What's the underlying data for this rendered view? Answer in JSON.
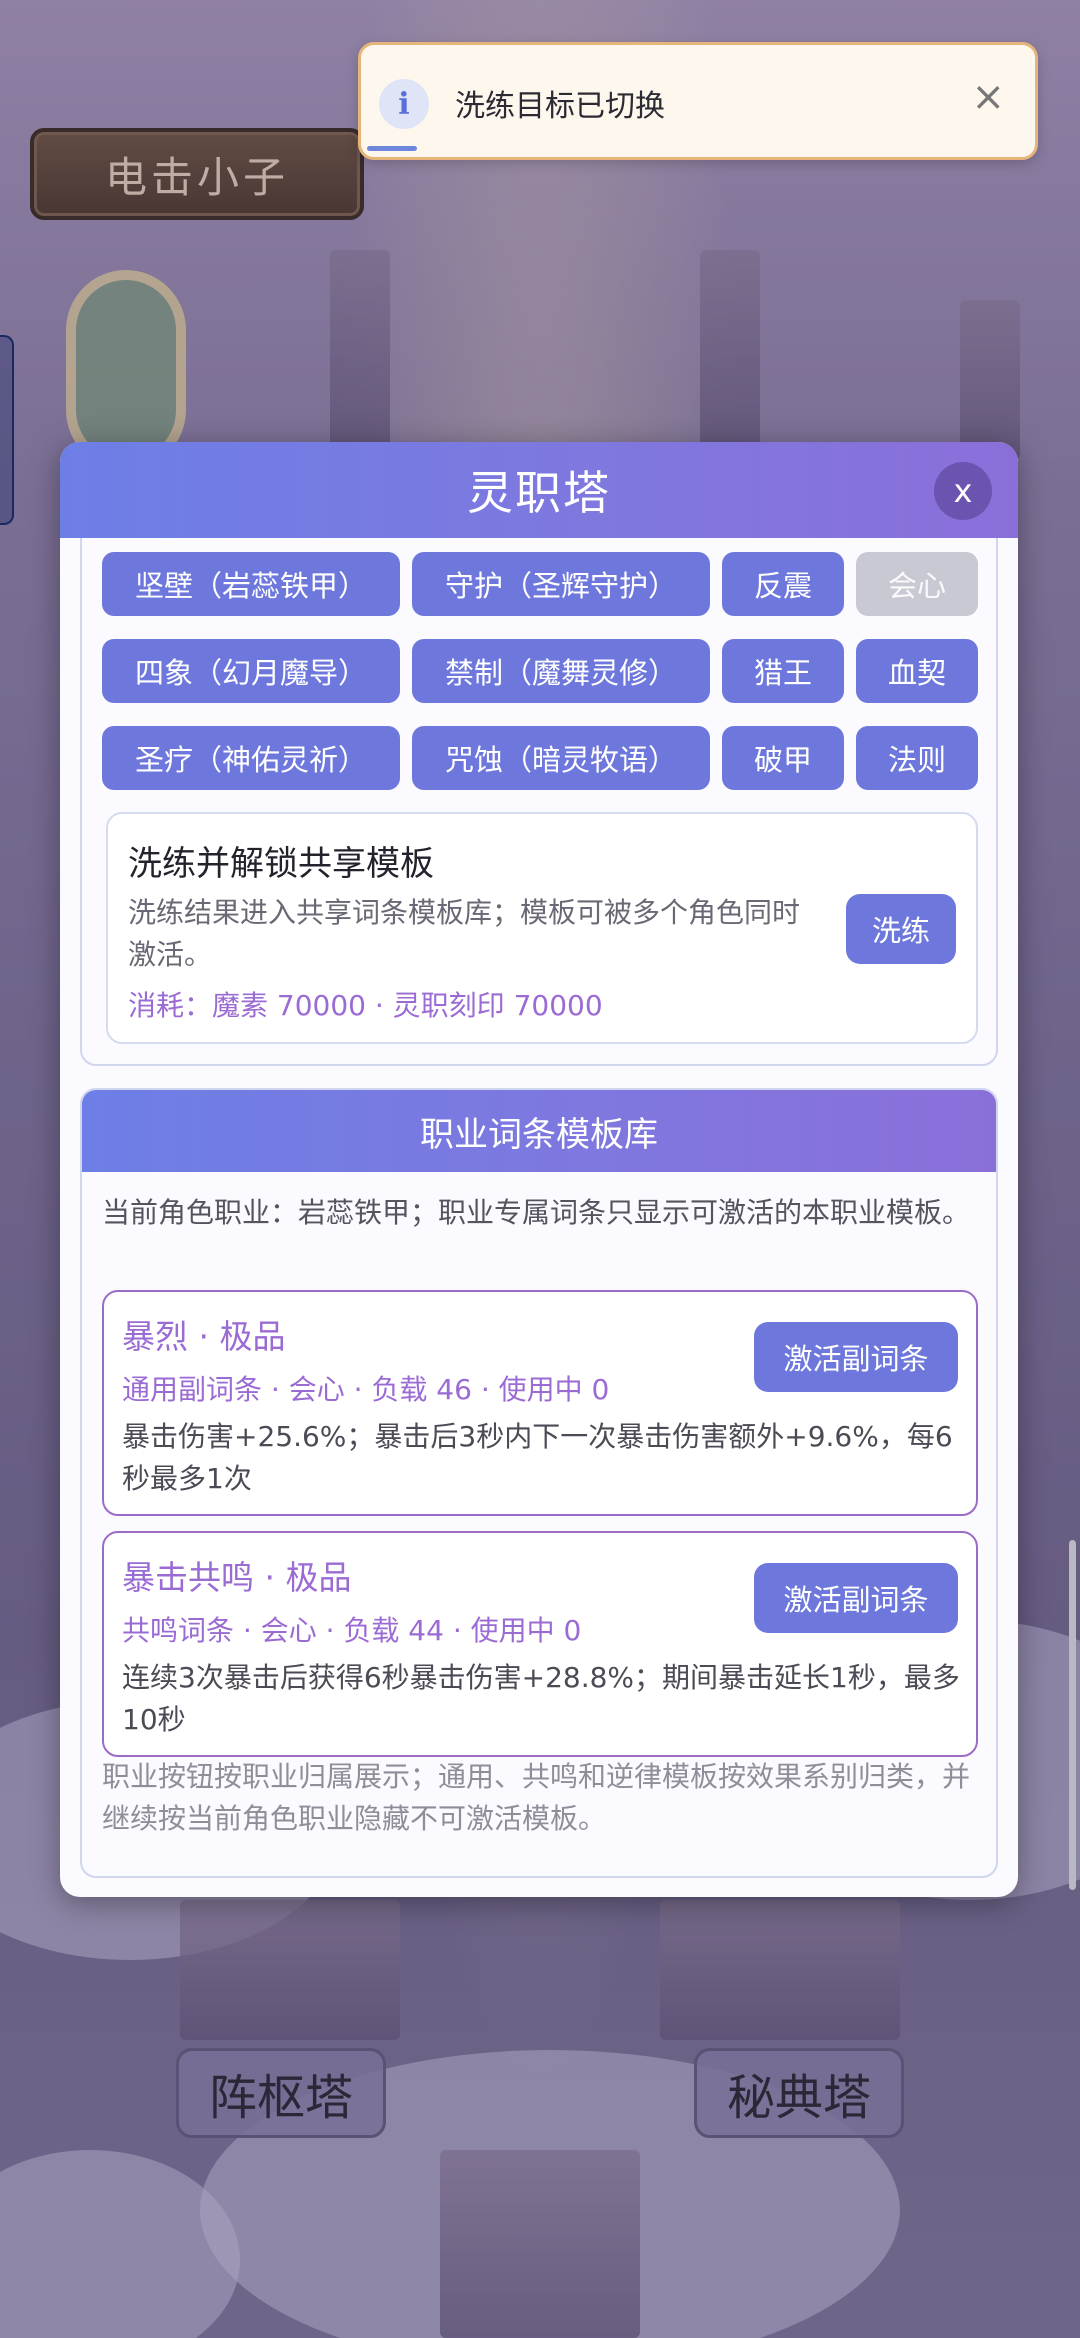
{
  "app": {
    "character_name": "电击小子",
    "accent": "#6e78dc",
    "header_gradient": [
      "#6d7fe6",
      "#8b6fd9"
    ]
  },
  "toast": {
    "icon": "info-icon",
    "message": "洗练目标已切换",
    "close_label": "×"
  },
  "modal": {
    "title": "灵职塔",
    "close_label": "x"
  },
  "class_tags": [
    {
      "label": "坚壁（岩蕊铁甲）",
      "disabled": false
    },
    {
      "label": "守护（圣辉守护）",
      "disabled": false
    },
    {
      "label": "反震",
      "disabled": false
    },
    {
      "label": "会心",
      "disabled": true
    },
    {
      "label": "四象（幻月魔导）",
      "disabled": false
    },
    {
      "label": "禁制（魔舞灵修）",
      "disabled": false
    },
    {
      "label": "猎王",
      "disabled": false
    },
    {
      "label": "血契",
      "disabled": false
    },
    {
      "label": "圣疗（神佑灵祈）",
      "disabled": false
    },
    {
      "label": "咒蚀（暗灵牧语）",
      "disabled": false
    },
    {
      "label": "破甲",
      "disabled": false
    },
    {
      "label": "法则",
      "disabled": false
    }
  ],
  "unlock": {
    "title": "洗练并解锁共享模板",
    "description": "洗练结果进入共享词条模板库；模板可被多个角色同时激活。",
    "cost": "消耗：魔素 70000 · 灵职刻印 70000",
    "button_label": "洗练"
  },
  "library": {
    "title": "职业词条模板库",
    "intro": "当前角色职业：岩蕊铁甲；职业专属词条只显示可激活的本职业模板。",
    "entries": [
      {
        "name": "暴烈 · 极品",
        "meta": "通用副词条 · 会心 · 负载 46 · 使用中 0",
        "effect": "暴击伤害+25.6%；暴击后3秒内下一次暴击伤害额外+9.6%，每6秒最多1次",
        "button_label": "激活副词条"
      },
      {
        "name": "暴击共鸣 · 极品",
        "meta": "共鸣词条 · 会心 · 负载 44 · 使用中 0",
        "effect": "连续3次暴击后获得6秒暴击伤害+28.8%；期间暴击延长1秒，最多10秒",
        "button_label": "激活副词条"
      }
    ],
    "footer": "职业按钮按职业归属展示；通用、共鸣和逆律模板按效果系别归类，并继续按当前角色职业隐藏不可激活模板。"
  },
  "bottom_towers": {
    "left": "阵枢塔",
    "right": "秘典塔"
  }
}
